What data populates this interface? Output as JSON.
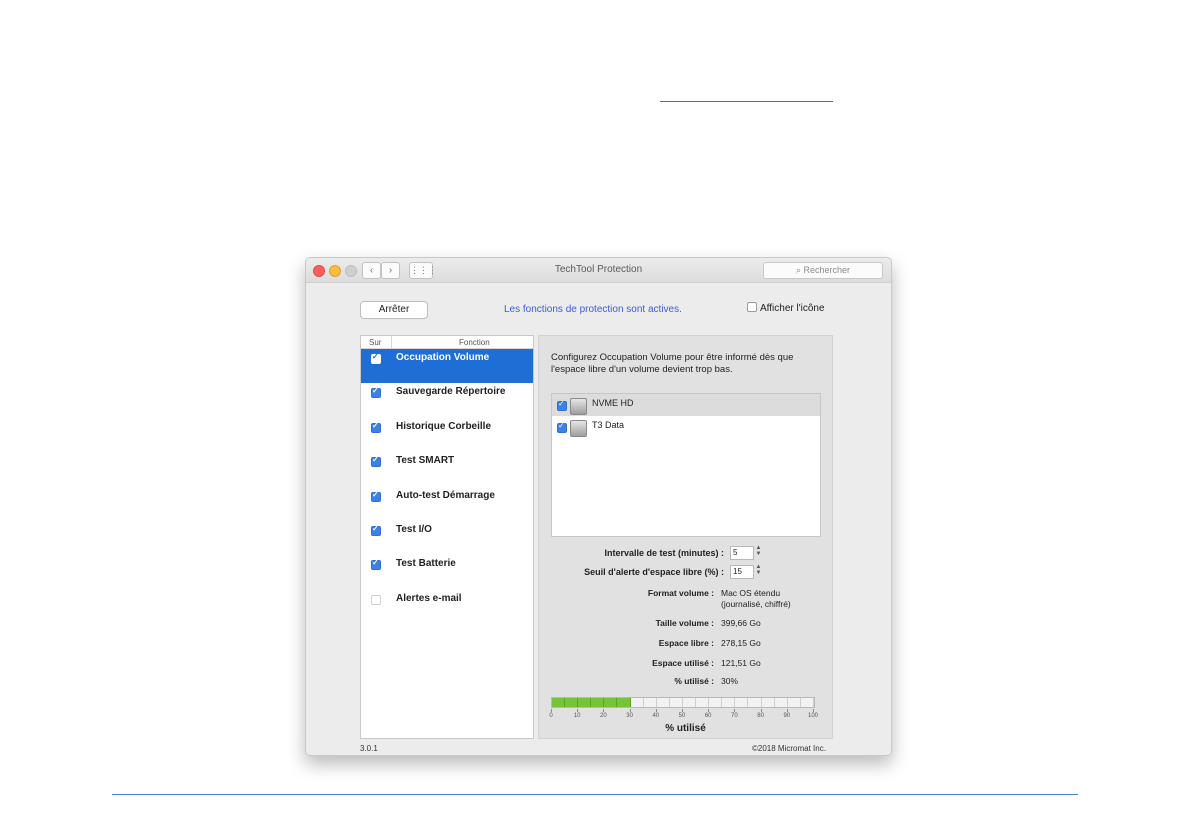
{
  "window": {
    "title": "TechTool Protection",
    "search_placeholder": "Rechercher",
    "nav_back": "‹",
    "nav_forward": "›",
    "grid_icon": "⋮⋮⋮"
  },
  "toolbar": {
    "stop_label": "Arrêter",
    "status_text": "Les fonctions de protection sont actives.",
    "menu_checkbox_label": "Afficher l'icône"
  },
  "function_list": {
    "header_on": "Sur",
    "header_function": "Fonction",
    "items": [
      {
        "label": "Occupation Volume",
        "checked": true,
        "selected": true
      },
      {
        "label": "Sauvegarde Répertoire",
        "checked": true,
        "selected": false
      },
      {
        "label": "Historique Corbeille",
        "checked": true,
        "selected": false
      },
      {
        "label": "Test SMART",
        "checked": true,
        "selected": false
      },
      {
        "label": "Auto-test Démarrage",
        "checked": true,
        "selected": false
      },
      {
        "label": "Test I/O",
        "checked": true,
        "selected": false
      },
      {
        "label": "Test Batterie",
        "checked": true,
        "selected": false
      },
      {
        "label": "Alertes e-mail",
        "checked": false,
        "selected": false
      }
    ]
  },
  "panel": {
    "description": "Configurez Occupation Volume pour être informé dès que l'espace libre d'un volume devient trop bas.",
    "volumes": [
      {
        "name": "NVME HD",
        "checked": true
      },
      {
        "name": "T3 Data",
        "checked": true
      }
    ],
    "interval_label": "Intervalle de test (minutes) :",
    "interval_value": "5",
    "threshold_label": "Seuil d'alerte d'espace libre (%) :",
    "threshold_value": "15",
    "format_label": "Format volume :",
    "format_value": "Mac OS étendu (journalisé, chiffré)",
    "size_label": "Taille volume :",
    "size_value": "399,66 Go",
    "free_label": "Espace libre :",
    "free_value": "278,15 Go",
    "used_label": "Espace utilisé :",
    "used_value": "121,51 Go",
    "percent_label": "% utilisé :",
    "percent_value": "30%",
    "usage_fraction": 0.3,
    "scale_ticks": [
      "0",
      "10",
      "20",
      "30",
      "40",
      "50",
      "60",
      "70",
      "80",
      "90",
      "100"
    ],
    "scale_caption": "% utilisé"
  },
  "footer": {
    "version": "3.0.1",
    "copyright": "©2018 Micromat Inc."
  },
  "colors": {
    "selection": "#1f6ed6",
    "checkbox": "#3b82e8",
    "status_text": "#3b5bd8",
    "usage_fill": "#79c33a"
  }
}
